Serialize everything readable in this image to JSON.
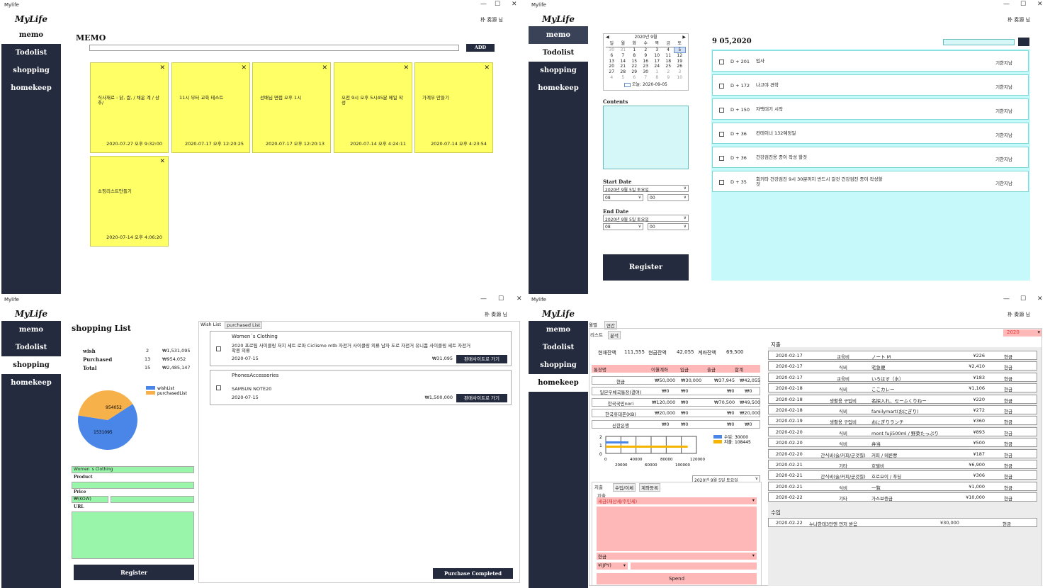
{
  "app": {
    "title": "Mylife",
    "user": "朴 奏源 님",
    "logo": "MyLife"
  },
  "nav": [
    "memo",
    "Todolist",
    "shopping",
    "homekeep"
  ],
  "memo": {
    "heading": "MEMO",
    "add_label": "ADD",
    "notes": [
      {
        "text": "식사재료 : 닭, 쌀, / 채운 계 / 상추/",
        "date": "2020-07-27 오후 9:32:00"
      },
      {
        "text": "11시 부터 교육 테스트",
        "date": "2020-07-17 오후 12:20:25"
      },
      {
        "text": "선배님 면접 오후 1시",
        "date": "2020-07-17 오후 12:20:13"
      },
      {
        "text": "오전 9시 오후 5시45분 메일 작성",
        "date": "2020-07-14 오후 4:24:11"
      },
      {
        "text": "가계부 만들기",
        "date": "2020-07-14 오후 4:23:54"
      },
      {
        "text": "쇼핑리스트만들기",
        "date": "2020-07-14 오후 4:06:20"
      }
    ]
  },
  "todo": {
    "calendar": {
      "month": "2020년 9월",
      "weekdays": [
        "일",
        "월",
        "화",
        "수",
        "목",
        "금",
        "토"
      ],
      "weeks": [
        [
          "30",
          "31",
          "1",
          "2",
          "3",
          "4",
          "5"
        ],
        [
          "6",
          "7",
          "8",
          "9",
          "10",
          "11",
          "12"
        ],
        [
          "13",
          "14",
          "15",
          "16",
          "17",
          "18",
          "19"
        ],
        [
          "20",
          "21",
          "22",
          "23",
          "24",
          "25",
          "26"
        ],
        [
          "27",
          "28",
          "29",
          "30",
          "1",
          "2",
          "3"
        ],
        [
          "4",
          "5",
          "6",
          "7",
          "8",
          "9",
          "10"
        ]
      ],
      "today": "오늘: 2020-09-05"
    },
    "contents_label": "Contents",
    "start_label": "Start Date",
    "end_label": "End Date",
    "start_date": "2020년  9월  5일 토요일",
    "end_date": "2020년  9월  5일 토요일",
    "hour": "08",
    "minute": "00",
    "register": "Register",
    "date_title": "9 05,2020",
    "items": [
      {
        "dday": "D + 201",
        "title": "입사",
        "status": "기한지남"
      },
      {
        "dday": "D + 172",
        "title": "나고야 견학",
        "status": "기한지남"
      },
      {
        "dday": "D + 150",
        "title": "자택대기 시작",
        "status": "기한지남"
      },
      {
        "dday": "D + 36",
        "title": "컨테이너 132예정일",
        "status": "기한지남"
      },
      {
        "dday": "D + 36",
        "title": "건강검진용 종이 작성 할것",
        "status": "기한지남"
      },
      {
        "dday": "D + 35",
        "title": "회키타 건강검진 9시 30분까지 반드시 갈것 건강검진 종이 작성할것",
        "status": "기한지남"
      }
    ]
  },
  "shopping": {
    "heading": "shopping List",
    "summary": [
      {
        "label": "wish",
        "count": "2",
        "amount": "₩1,531,095"
      },
      {
        "label": "Purchased",
        "count": "13",
        "amount": "₩954,052"
      },
      {
        "label": "Total",
        "count": "15",
        "amount": "₩2,485,147"
      }
    ],
    "legend": [
      "wishList",
      "purchasedList"
    ],
    "pie_values": {
      "wish": 1531095,
      "purchased": 954052
    },
    "pie_labels": [
      "954052",
      "1531095"
    ],
    "category": "Women´s Clothing",
    "product_label": "Product",
    "price_label": "Price",
    "currency": "₩(KOW)",
    "url_label": "URL",
    "register": "Register",
    "tabs": [
      "Wish List",
      "purchased List"
    ],
    "items": [
      {
        "cat": "Women´s Clothing",
        "name": "2020 프로팀 사이클링 저지 세트 로파 Ciclismo mtb 자전거 사이클링 의류 남자 도로 자전거 유니폼 사이클링 세트 자전거 착용 의류",
        "date": "2020-07-15",
        "price": "₩31,095",
        "go": "판매사이트로 가기"
      },
      {
        "cat": "PhonesAccessories",
        "name": "SAMSUN NOTE20",
        "date": "2020-07-15",
        "price": "₩1,500,000",
        "go": "판매사이트로 가기"
      }
    ],
    "complete": "Purchase Completed"
  },
  "home": {
    "tabs": [
      "월별",
      "연간"
    ],
    "subtabs": [
      "리스트",
      "분석"
    ],
    "year": "2020",
    "balance": {
      "now_label": "현재잔액",
      "now": "111,555",
      "cash_label": "현금잔액",
      "cash": "42,055",
      "acct_label": "계좌잔액",
      "acct": "69,500"
    },
    "acc_header": [
      "통장명",
      "이월계좌",
      "입금",
      "출금",
      "합계"
    ],
    "accounts": [
      [
        "현금",
        "₩50,000",
        "₩30,000",
        "₩37,945",
        "₩42,055"
      ],
      [
        "일본우체국통장(결여)",
        "₩0",
        "₩0",
        "₩0",
        "₩0"
      ],
      [
        "한국국민nori",
        "₩120,000",
        "₩0",
        "₩70,500",
        "₩49,500"
      ],
      [
        "한국휴대폰(KB)",
        "₩20,000",
        "₩0",
        "₩0",
        "₩20,000"
      ],
      [
        "신한은행",
        "₩0",
        "₩0",
        "₩0",
        "₩0"
      ]
    ],
    "chart_data": {
      "type": "bar",
      "orientation": "horizontal",
      "series": [
        {
          "name": "수입: 30000",
          "values": [
            30000
          ],
          "color": "#4a86e8"
        },
        {
          "name": "지출: 108445",
          "values": [
            108445
          ],
          "color": "#f4b400"
        }
      ],
      "xticks": [
        "0",
        "20000",
        "40000",
        "60000",
        "80000",
        "100000",
        "120000"
      ],
      "yticks": [
        "2",
        "1",
        "0"
      ],
      "xlim": [
        0,
        120000
      ]
    },
    "date": "2020년  9월  5일 토요일",
    "form_tabs": [
      "지출",
      "수입/이체",
      "계좌등록"
    ],
    "form_label": "지출",
    "tax": "세금(재산세/주민세)",
    "pay": "현금",
    "currency": "¥(JPY)",
    "spend": "Spend",
    "expense_title": "지출",
    "income_title": "수입",
    "expenses": [
      [
        "2020-02-17",
        "교육비",
        "ノート M",
        "¥226",
        "현금"
      ],
      [
        "2020-02-17",
        "식비",
        "宅急便",
        "¥2,410",
        "현금"
      ],
      [
        "2020-02-17",
        "교육비",
        "いろはす（水）",
        "¥183",
        "현금"
      ],
      [
        "2020-02-18",
        "식비",
        "ここカレー",
        "¥1,106",
        "현금"
      ],
      [
        "2020-02-18",
        "생활용 구입비",
        "名探入れ、セーふくりねー",
        "¥220",
        "현금"
      ],
      [
        "2020-02-18",
        "식비",
        "familymart(おにぎり)",
        "¥272",
        "현금"
      ],
      [
        "2020-02-19",
        "생활용 구입비",
        "おにぎりランチ",
        "¥360",
        "현금"
      ],
      [
        "2020-02-20",
        "식비",
        "mont fuji500ml / 野菜たっぷり",
        "¥893",
        "현금"
      ],
      [
        "2020-02-20",
        "식비",
        "弁当",
        "¥500",
        "현금"
      ],
      [
        "2020-02-20",
        "간식비(술/커피/군것질)",
        "커피 / 메론빵",
        "¥187",
        "현금"
      ],
      [
        "2020-02-21",
        "기타",
        "호텔비",
        "¥6,900",
        "현금"
      ],
      [
        "2020-02-21",
        "간식비(술/커피/군것질)",
        "호로요이 / 푸딩",
        "¥306",
        "현금"
      ],
      [
        "2020-02-21",
        "식비",
        "一覧",
        "¥1,000",
        "현금"
      ],
      [
        "2020-02-22",
        "기타",
        "가스보증금",
        "¥10,000",
        "현금"
      ]
    ],
    "incomes": [
      [
        "2020-02-22",
        "누나한테3만엔 먼저 받음",
        "¥30,000",
        "현금"
      ]
    ]
  }
}
